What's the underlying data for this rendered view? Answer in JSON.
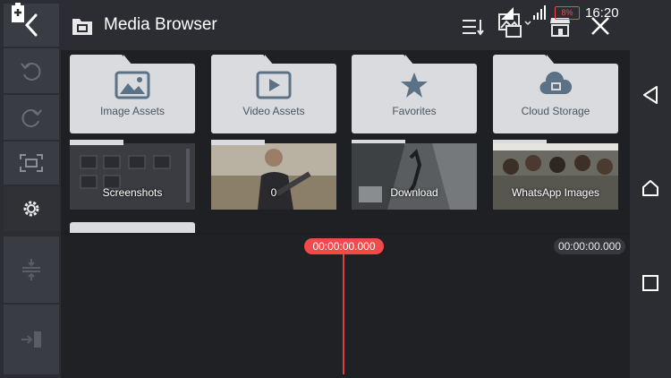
{
  "header": {
    "title": "Media Browser",
    "icons": [
      "back-icon",
      "media-browser-icon",
      "sort-icon",
      "media-type-filter-icon",
      "store-icon",
      "close-icon"
    ]
  },
  "status_bar": {
    "battery_percent": "8%",
    "time": "16:20"
  },
  "left_toolbar": {
    "items": [
      "undo-icon",
      "redo-icon",
      "fit-screen-icon",
      "settings-icon",
      "split-icon",
      "import-icon"
    ]
  },
  "folders": [
    {
      "label": "Image Assets",
      "icon": "image-icon"
    },
    {
      "label": "Video Assets",
      "icon": "video-play-icon"
    },
    {
      "label": "Favorites",
      "icon": "star-icon"
    },
    {
      "label": "Cloud Storage",
      "icon": "cloud-film-icon"
    }
  ],
  "media_folders": [
    {
      "label": "Screenshots"
    },
    {
      "label": "0"
    },
    {
      "label": "Download"
    },
    {
      "label": "WhatsApp Images"
    }
  ],
  "timeline": {
    "playhead_time": "00:00:00.000",
    "total_time": "00:00:00.000"
  },
  "colors": {
    "accent": "#f04a4a",
    "panel": "#2b2d33",
    "folder": "#d9dbde"
  }
}
